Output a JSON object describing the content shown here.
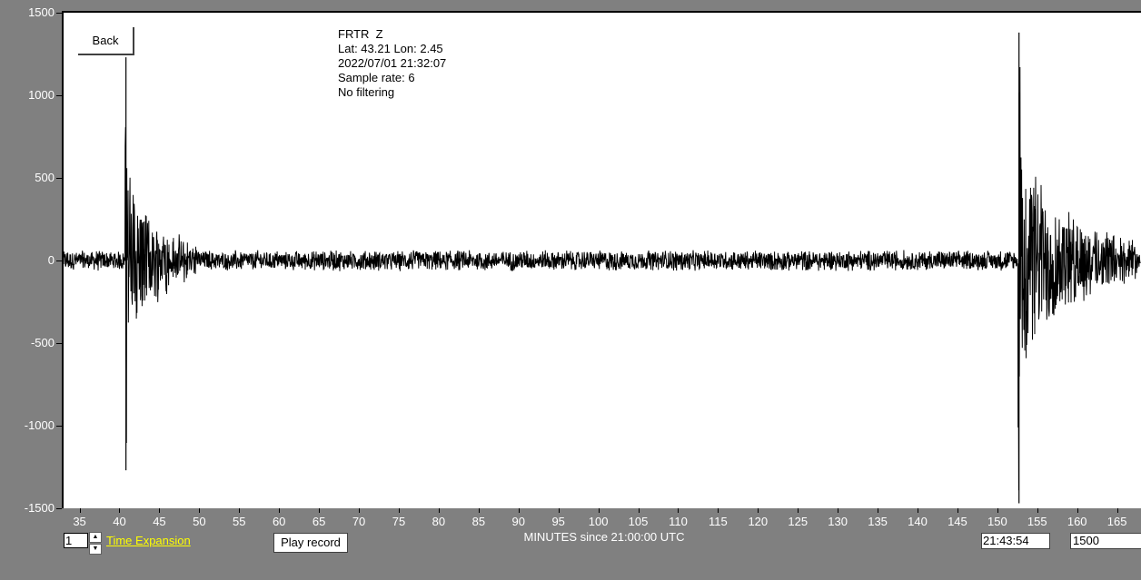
{
  "header": {
    "station": "FRTR  Z",
    "location": "Lat: 43.21 Lon: 2.45",
    "datetime": "2022/07/01 21:32:07",
    "sample_rate": "Sample rate: 6",
    "filter": "No filtering"
  },
  "buttons": {
    "back": "Back",
    "play": "Play record"
  },
  "controls": {
    "time_expansion_value": "1",
    "time_expansion_label": "Time Expansion",
    "time_readout": "21:43:54",
    "amplitude_scale": "1500"
  },
  "colors": {
    "background": "#808080",
    "plot": "#ffffff",
    "trace": "#000000",
    "expansion_label": "#ffff00"
  },
  "chart_data": {
    "type": "line",
    "title": "",
    "xlabel": "MINUTES since 21:00:00 UTC",
    "ylabel": "",
    "xlim": [
      33,
      168
    ],
    "ylim": [
      -1500,
      1500
    ],
    "y_ticks": [
      "1500",
      "1000",
      "500",
      "0",
      "-500",
      "-1000",
      "-1500"
    ],
    "x_ticks": [
      "35",
      "40",
      "45",
      "50",
      "55",
      "60",
      "65",
      "70",
      "75",
      "80",
      "85",
      "90",
      "95",
      "100",
      "105",
      "110",
      "115",
      "120",
      "125",
      "130",
      "135",
      "140",
      "145",
      "150",
      "155",
      "160",
      "165"
    ],
    "grid": false,
    "series": [
      {
        "description_values": "seismogram trace",
        "background_noise_amplitude": 60,
        "events": [
          {
            "onset_min": 40.7,
            "peak_pos": 1230,
            "peak_neg": -1270,
            "coda_amplitude": 180,
            "decay_min": 3
          },
          {
            "onset_min": 152.6,
            "peak_pos": 1380,
            "peak_neg": -1470,
            "coda_amplitude": 220,
            "decay_min": 5
          }
        ]
      }
    ]
  }
}
